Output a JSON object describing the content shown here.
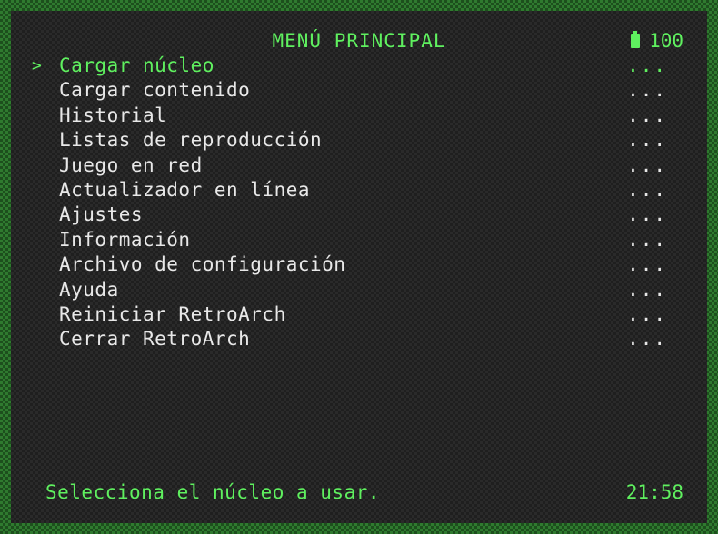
{
  "header": {
    "title": "MENÚ PRINCIPAL",
    "battery_level": "100",
    "battery_icon": "battery-icon"
  },
  "menu": {
    "cursor": ">",
    "items": [
      {
        "label": "Cargar núcleo",
        "value": "...",
        "selected": true
      },
      {
        "label": "Cargar contenido",
        "value": "..."
      },
      {
        "label": "Historial",
        "value": "..."
      },
      {
        "label": "Listas de reproducción",
        "value": "..."
      },
      {
        "label": "Juego en red",
        "value": "..."
      },
      {
        "label": "Actualizador en línea",
        "value": "..."
      },
      {
        "label": "Ajustes",
        "value": "..."
      },
      {
        "label": "Información",
        "value": "..."
      },
      {
        "label": "Archivo de configuración",
        "value": "..."
      },
      {
        "label": "Ayuda",
        "value": "..."
      },
      {
        "label": "Reiniciar RetroArch",
        "value": "..."
      },
      {
        "label": "Cerrar RetroArch",
        "value": "..."
      }
    ]
  },
  "footer": {
    "sublabel": "Selecciona el núcleo a usar.",
    "clock": "21:58"
  },
  "colors": {
    "accent": "#5ff05f",
    "text": "#e8e8e8",
    "background": "#2a2a2a",
    "border": "#2f7a2f"
  }
}
